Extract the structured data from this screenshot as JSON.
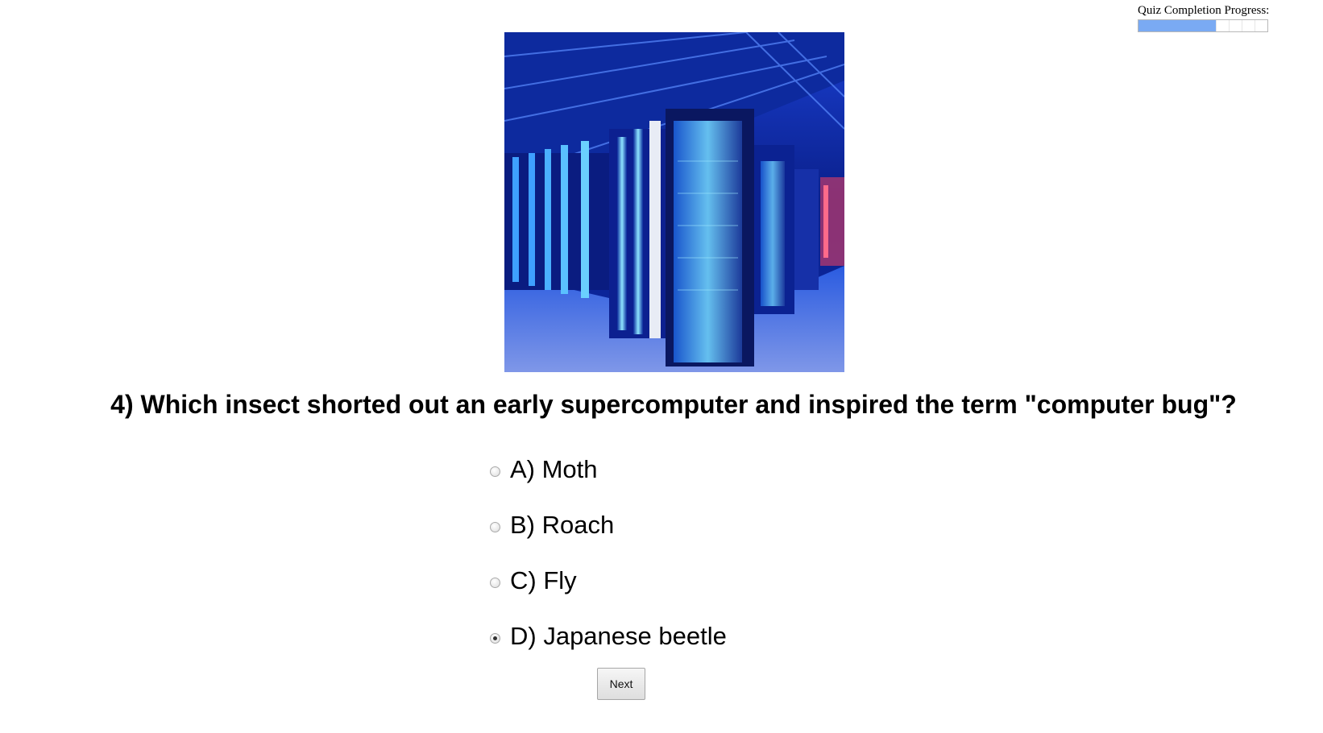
{
  "progress": {
    "label": "Quiz Completion Progress:",
    "fraction": 0.6,
    "segments": 10,
    "fill_color": "#7aaaf3"
  },
  "image": {
    "alt": "Data center server racks lit in blue"
  },
  "question": {
    "text": "4) Which insect shorted out an early supercomputer and inspired the term \"computer bug\"?"
  },
  "options": [
    {
      "label": "A) Moth",
      "selected": false
    },
    {
      "label": "B) Roach",
      "selected": false
    },
    {
      "label": "C) Fly",
      "selected": false
    },
    {
      "label": "D) Japanese beetle",
      "selected": true
    }
  ],
  "buttons": {
    "next_label": "Next"
  }
}
